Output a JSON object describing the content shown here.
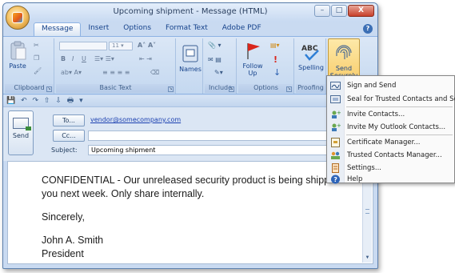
{
  "window": {
    "title": "Upcoming shipment - Message (HTML)",
    "controls": [
      "–",
      "□",
      "X"
    ]
  },
  "ribbon_tabs": [
    "Message",
    "Insert",
    "Options",
    "Format Text",
    "Adobe PDF"
  ],
  "ribbon": {
    "clipboard": {
      "paste": "Paste",
      "label": "Clipboard"
    },
    "basic_text": {
      "font_size": "11",
      "bold": "B",
      "italic": "I",
      "underline": "U",
      "label": "Basic Text"
    },
    "names": {
      "label": "Names"
    },
    "include": {
      "label": "Include"
    },
    "options": {
      "follow_up": "Follow",
      "follow_up2": "Up",
      "priority": "!",
      "label": "Options"
    },
    "proofing": {
      "spelling": "Spelling",
      "label": "Proofing"
    },
    "send_securely": {
      "line1": "Send",
      "line2": "Securely"
    }
  },
  "message": {
    "send_label": "Send",
    "to_label": "To...",
    "to_value": "vendor@somecompany.com",
    "cc_label": "Cc...",
    "cc_value": "",
    "subject_label": "Subject:",
    "subject_value": "Upcoming shipment",
    "body": [
      "CONFIDENTIAL -  Our unreleased security product is being shipped to you next week.  Only share internally.",
      "Sincerely,",
      "John A. Smith President"
    ],
    "signature_name": "John A. Smith",
    "signature_title": "President"
  },
  "menu": {
    "items": [
      {
        "label": "Sign and Send",
        "icon": "sign-icon"
      },
      {
        "label": "Seal for Trusted Contacts and Send",
        "icon": "seal-icon"
      },
      {
        "label": "Invite Contacts...",
        "icon": "invite-contacts-icon"
      },
      {
        "label": "Invite My Outlook Contacts...",
        "icon": "outlook-contacts-icon"
      },
      {
        "label": "Certificate Manager...",
        "icon": "certificate-icon"
      },
      {
        "label": "Trusted Contacts Manager...",
        "icon": "trusted-contacts-icon"
      },
      {
        "label": "Settings...",
        "icon": "settings-icon"
      },
      {
        "label": "Help",
        "icon": "help-icon"
      }
    ]
  }
}
